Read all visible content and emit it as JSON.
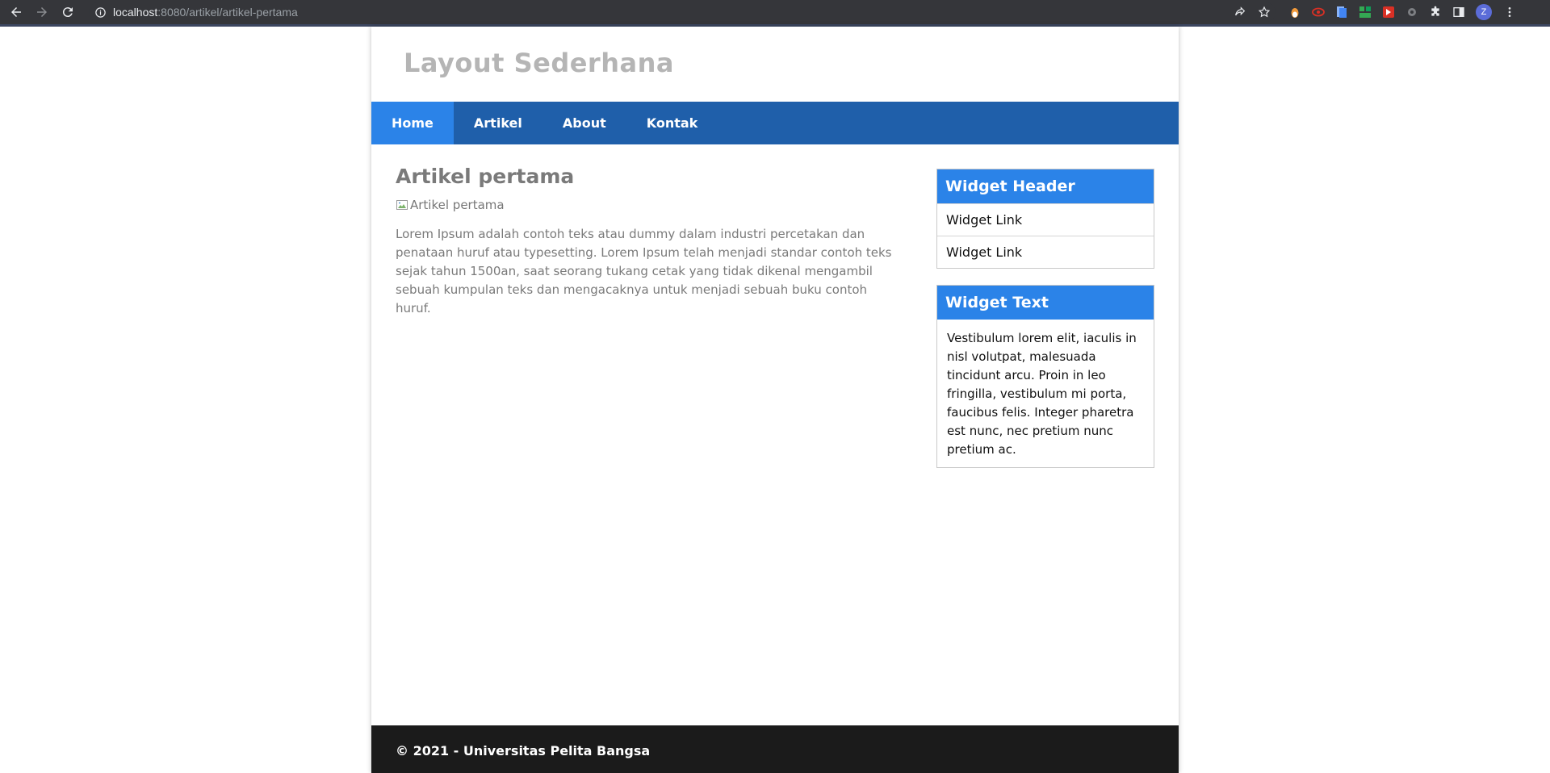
{
  "browser": {
    "url_host": "localhost",
    "url_rest": ":8080/artikel/artikel-pertama",
    "profile_initial": "Z"
  },
  "site": {
    "title": "Layout Sederhana"
  },
  "nav": {
    "items": [
      {
        "label": "Home"
      },
      {
        "label": "Artikel"
      },
      {
        "label": "About"
      },
      {
        "label": "Kontak"
      }
    ],
    "active": "Home"
  },
  "article": {
    "title": "Artikel pertama",
    "image_alt": "Artikel pertama",
    "body": "Lorem Ipsum adalah contoh teks atau dummy dalam industri percetakan dan penataan huruf atau typesetting. Lorem Ipsum telah menjadi standar contoh teks sejak tahun 1500an, saat seorang tukang cetak yang tidak dikenal mengambil sebuah kumpulan teks dan mengacaknya untuk menjadi sebuah buku contoh huruf."
  },
  "sidebar": {
    "widget1": {
      "header": "Widget Header",
      "links": [
        "Widget Link",
        "Widget Link"
      ]
    },
    "widget2": {
      "header": "Widget Text",
      "body": "Vestibulum lorem elit, iaculis in nisl volutpat, malesuada tincidunt arcu. Proin in leo fringilla, vestibulum mi porta, faucibus felis. Integer pharetra est nunc, nec pretium nunc pretium ac."
    }
  },
  "footer": {
    "text": "© 2021 - Universitas Pelita Bangsa"
  },
  "colors": {
    "nav_bg": "#1f5faa",
    "accent": "#2b83e8",
    "footer_bg": "#1b1b1b",
    "title_gray": "#b5b5b5"
  }
}
